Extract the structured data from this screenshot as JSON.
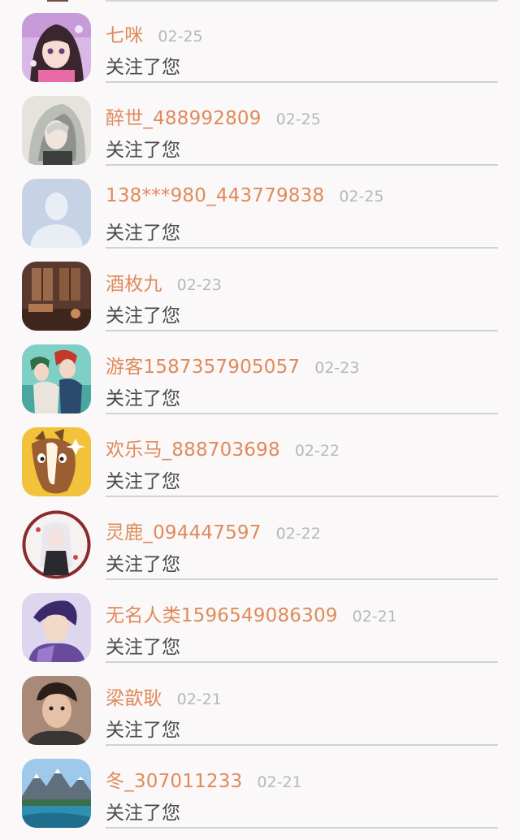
{
  "notifications": [
    {
      "name": "七咪",
      "date": "02-25",
      "action": "关注了您",
      "avatar": "anime-girl-avatar"
    },
    {
      "name": "醉世_488992809",
      "date": "02-25",
      "action": "关注了您",
      "avatar": "silver-hair-avatar"
    },
    {
      "name": "138***980_443779838",
      "date": "02-25",
      "action": "关注了您",
      "avatar": "default-person-avatar"
    },
    {
      "name": "酒枚九",
      "date": "02-23",
      "action": "关注了您",
      "avatar": "room-scene-avatar"
    },
    {
      "name": "游客1587357905057",
      "date": "02-23",
      "action": "关注了您",
      "avatar": "anime-couple-avatar"
    },
    {
      "name": "欢乐马_888703698",
      "date": "02-22",
      "action": "关注了您",
      "avatar": "cartoon-horse-avatar"
    },
    {
      "name": "灵鹿_094447597",
      "date": "02-22",
      "action": "关注了您",
      "avatar": "white-hair-anime-avatar"
    },
    {
      "name": "无名人类1596549086309",
      "date": "02-21",
      "action": "关注了您",
      "avatar": "purple-anime-boy-avatar"
    },
    {
      "name": "梁歆耿",
      "date": "02-21",
      "action": "关注了您",
      "avatar": "young-man-photo-avatar"
    },
    {
      "name": "冬_307011233",
      "date": "02-21",
      "action": "关注了您",
      "avatar": "mountain-lake-avatar"
    }
  ]
}
